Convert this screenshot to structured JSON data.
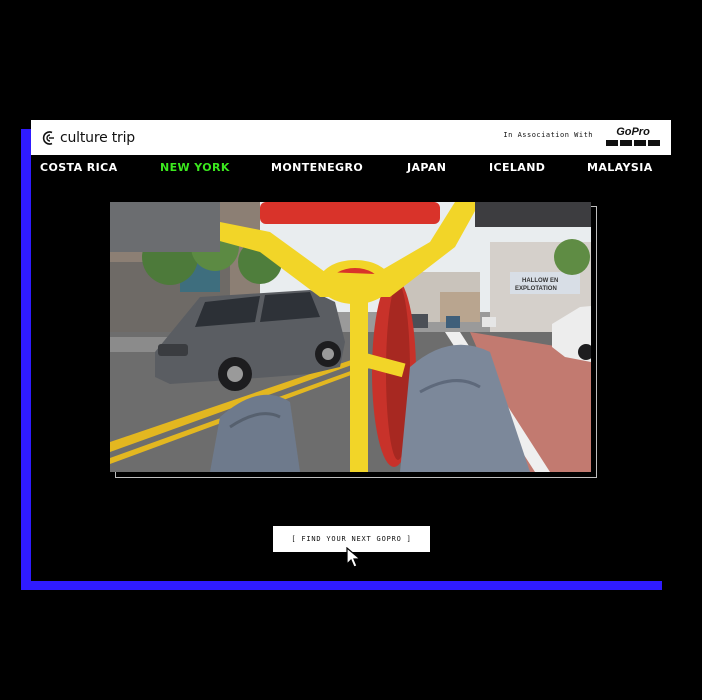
{
  "header": {
    "brand_name": "culture trip",
    "brand_icon": "culture-trip-logo-icon",
    "association_text": "In Association With",
    "partner_logo_text": "GoPro"
  },
  "nav": {
    "items": [
      {
        "label": "COSTA RICA",
        "active": false
      },
      {
        "label": "NEW YORK",
        "active": true
      },
      {
        "label": "MONTENEGRO",
        "active": false
      },
      {
        "label": "JAPAN",
        "active": false
      },
      {
        "label": "ICELAND",
        "active": false
      },
      {
        "label": "MALAYSIA",
        "active": false
      }
    ]
  },
  "video": {
    "description_icon": "bike-ride-video",
    "storefront_sign": "HALLOW EN\nEXPLOTATION"
  },
  "cta": {
    "label": "[ FIND YOUR NEXT GOPRO ]"
  },
  "colors": {
    "accent_blue": "#2F1BFF",
    "active_nav_green": "#3BE81E",
    "background": "#000000",
    "header_bg": "#FFFFFF"
  }
}
